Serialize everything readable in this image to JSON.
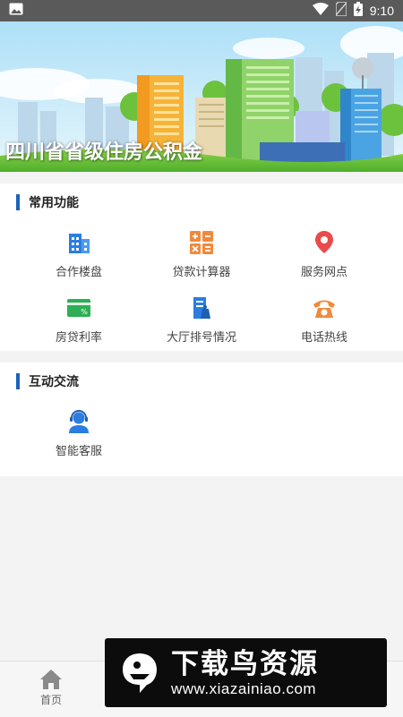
{
  "status_bar": {
    "time": "9:10",
    "icons": [
      "image-icon",
      "wifi-icon",
      "no-sim-icon",
      "battery-charging-icon"
    ]
  },
  "banner": {
    "title": "四川省省级住房公积金"
  },
  "sections": {
    "common": {
      "title": "常用功能",
      "items": [
        {
          "label": "合作楼盘",
          "icon": "building-icon",
          "color": "#2b7de0"
        },
        {
          "label": "贷款计算器",
          "icon": "calculator-icon",
          "color": "#f08a3c"
        },
        {
          "label": "服务网点",
          "icon": "location-pin-icon",
          "color": "#e94b4b"
        },
        {
          "label": "房贷利率",
          "icon": "rate-card-icon",
          "color": "#2fae55"
        },
        {
          "label": "大厅排号情况",
          "icon": "queue-ticket-icon",
          "color": "#2b7de0"
        },
        {
          "label": "电话热线",
          "icon": "phone-icon",
          "color": "#f08a3c"
        }
      ]
    },
    "interaction": {
      "title": "互动交流",
      "items": [
        {
          "label": "智能客服",
          "icon": "customer-service-icon",
          "color": "#2b7de0"
        }
      ]
    }
  },
  "bottom_nav": {
    "home_label": "首页"
  },
  "watermark": {
    "main_text": "下载鸟资源",
    "url": "www.xiazainiao.com"
  },
  "colors": {
    "accent": "#1c62b9",
    "background": "#f3f3f3",
    "status_bar": "#5a5a5a"
  }
}
